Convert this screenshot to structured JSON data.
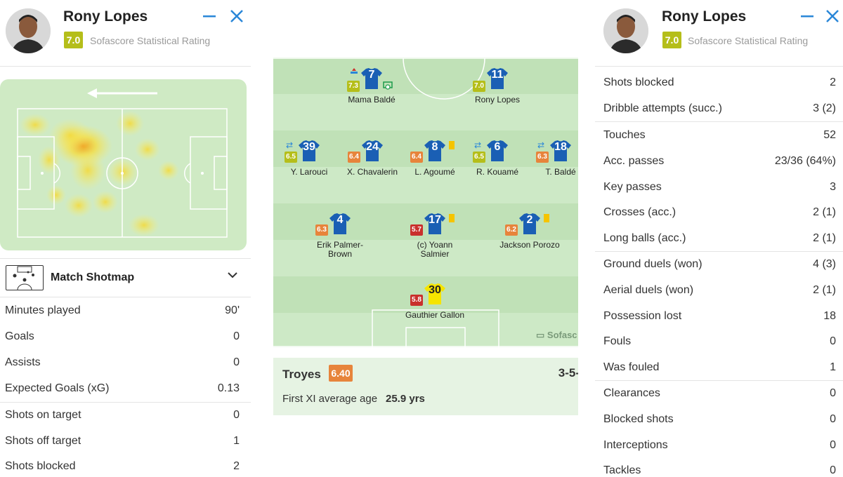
{
  "left_panel": {
    "player_name": "Rony Lopes",
    "rating": "7.0",
    "rating_label": "Sofascore Statistical Rating",
    "shotmap_label": "Match Shotmap",
    "stats": [
      {
        "label": "Minutes played",
        "value": "90'"
      },
      {
        "label": "Goals",
        "value": "0"
      },
      {
        "label": "Assists",
        "value": "0"
      },
      {
        "label": "Expected Goals (xG)",
        "value": "0.13"
      },
      {
        "label": "Shots on target",
        "value": "0"
      },
      {
        "label": "Shots off target",
        "value": "1"
      },
      {
        "label": "Shots blocked",
        "value": "2"
      }
    ]
  },
  "right_panel": {
    "player_name": "Rony Lopes",
    "rating": "7.0",
    "rating_label": "Sofascore Statistical Rating",
    "stats": [
      {
        "label": "Shots blocked",
        "value": "2"
      },
      {
        "label": "Dribble attempts (succ.)",
        "value": "3 (2)"
      },
      {
        "label": "Touches",
        "value": "52"
      },
      {
        "label": "Acc. passes",
        "value": "23/36 (64%)"
      },
      {
        "label": "Key passes",
        "value": "3"
      },
      {
        "label": "Crosses (acc.)",
        "value": "2 (1)"
      },
      {
        "label": "Long balls (acc.)",
        "value": "2 (1)"
      },
      {
        "label": "Ground duels (won)",
        "value": "4 (3)"
      },
      {
        "label": "Aerial duels (won)",
        "value": "2 (1)"
      },
      {
        "label": "Possession lost",
        "value": "18"
      },
      {
        "label": "Fouls",
        "value": "0"
      },
      {
        "label": "Was fouled",
        "value": "1"
      },
      {
        "label": "Clearances",
        "value": "0"
      },
      {
        "label": "Blocked shots",
        "value": "0"
      },
      {
        "label": "Interceptions",
        "value": "0"
      },
      {
        "label": "Tackles",
        "value": "0"
      }
    ]
  },
  "lineup": {
    "players": [
      {
        "id": "balde-m",
        "number": "7",
        "name": "Mama Baldé",
        "rating": "7.3",
        "rating_color": "#b5be1a"
      },
      {
        "id": "lopes",
        "number": "11",
        "name": "Rony Lopes",
        "rating": "7.0",
        "rating_color": "#b5be1a"
      },
      {
        "id": "larouci",
        "number": "39",
        "name": "Y. Larouci",
        "rating": "6.5",
        "rating_color": "#b5be1a"
      },
      {
        "id": "chavalerin",
        "number": "24",
        "name": "X. Chavalerin",
        "rating": "6.4",
        "rating_color": "#e7843b"
      },
      {
        "id": "agoume",
        "number": "8",
        "name": "L. Agoumé",
        "rating": "6.4",
        "rating_color": "#e7843b"
      },
      {
        "id": "kouame",
        "number": "6",
        "name": "R. Kouamé",
        "rating": "6.5",
        "rating_color": "#b5be1a"
      },
      {
        "id": "balde-t",
        "number": "18",
        "name": "T. Baldé",
        "rating": "6.3",
        "rating_color": "#e7843b"
      },
      {
        "id": "palmer",
        "number": "4",
        "name": "Erik Palmer-Brown",
        "rating": "6.3",
        "rating_color": "#e7843b"
      },
      {
        "id": "salmier",
        "number": "17",
        "name": "(c) Yoann Salmier",
        "rating": "5.7",
        "rating_color": "#c9302c"
      },
      {
        "id": "porozo",
        "number": "2",
        "name": "Jackson Porozo",
        "rating": "6.2",
        "rating_color": "#e7843b"
      },
      {
        "id": "gallon",
        "number": "30",
        "name": "Gauthier Gallon",
        "rating": "5.8",
        "rating_color": "#c9302c"
      }
    ],
    "watermark": "Sofasc",
    "team_name": "Troyes",
    "team_rating": "6.40",
    "formation": "3-5-",
    "avg_age_label": "First XI average age",
    "avg_age_value": "25.9 yrs"
  },
  "colors": {
    "accent": "#2a87d8",
    "jersey": "#1a5fb4",
    "goalkeeper_jersey": "#f5e400",
    "pitch_light": "#cde9c6",
    "pitch_dark": "#c0e1b7"
  }
}
